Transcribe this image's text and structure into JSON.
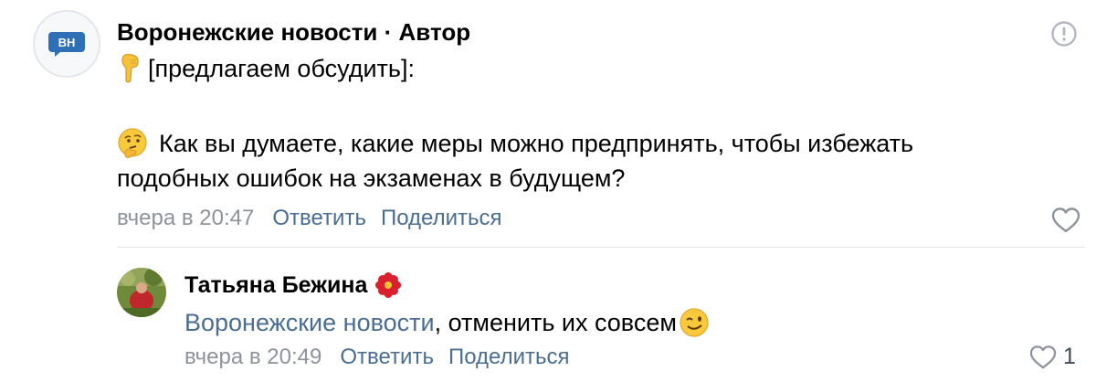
{
  "comment": {
    "avatar_text": "ВН",
    "author": "Воронежские новости",
    "separator": " · ",
    "author_badge": "Автор",
    "lines": [
      "[предлагаем обсудить]:",
      "Как вы думаете, какие меры можно предпринять, чтобы избежать",
      "подобных ошибок на экзаменах в будущем?"
    ],
    "time": "вчера в 20:47",
    "reply_label": "Ответить",
    "share_label": "Поделиться"
  },
  "reply": {
    "author": "Татьяна Бежина",
    "mention": "Воронежские новости",
    "text": ", отменить их совсем",
    "time": "вчера в 20:49",
    "reply_label": "Ответить",
    "share_label": "Поделиться",
    "likes": "1"
  },
  "icons": {
    "report": "exclamation-circle-icon",
    "pointing": "hand-pointing-down-emoji",
    "thinking": "thinking-face-emoji",
    "flower": "red-flower-emoji",
    "wink": "winking-face-emoji",
    "like": "heart-outline-icon"
  },
  "colors": {
    "link": "#4a6d92",
    "meta": "#8e939b",
    "brand": "#2f6fb5"
  }
}
